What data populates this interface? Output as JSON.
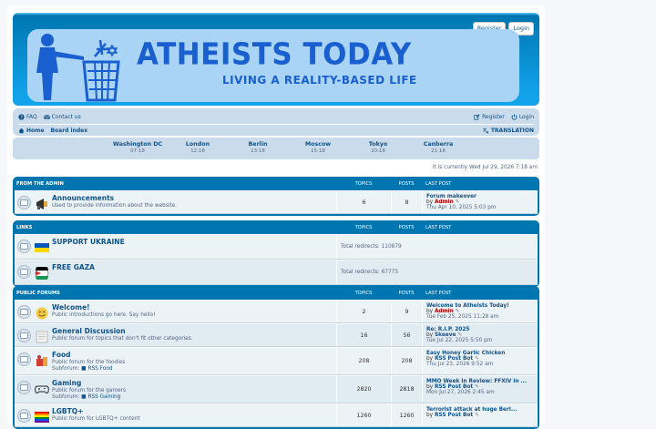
{
  "header": {
    "register": "Register",
    "login": "Login",
    "title": "ATHEISTS TODAY",
    "subtitle": "LIVING A REALITY-BASED LIFE"
  },
  "nav": {
    "faq": "FAQ",
    "contact": "Contact us",
    "register": "Register",
    "login": "Login",
    "home": "Home",
    "board_index": "Board index",
    "translation": "TRANSLATION"
  },
  "clocks": [
    {
      "city": "Washington DC",
      "time": "07:18"
    },
    {
      "city": "London",
      "time": "12:18"
    },
    {
      "city": "Berlin",
      "time": "13:18"
    },
    {
      "city": "Moscow",
      "time": "15:18"
    },
    {
      "city": "Tokyo",
      "time": "20:18"
    },
    {
      "city": "Canberra",
      "time": "21:18"
    }
  ],
  "current_time": "It is currently Wed Jul 29, 2026 7:18 am",
  "columns": {
    "topics": "TOPICS",
    "posts": "POSTS",
    "last_post": "LAST POST"
  },
  "categories": [
    {
      "name": "FROM THE ADMIN",
      "forums": [
        {
          "title": "Announcements",
          "desc": "Used to provide information about the website.",
          "topics": "6",
          "posts": "8",
          "last_title": "Forum makeover",
          "by": "by",
          "last_user": "Admin",
          "last_date": "Thu Apr 10, 2025 5:03 pm"
        }
      ]
    },
    {
      "name": "LINKS",
      "forums": [
        {
          "title": "SUPPORT UKRAINE",
          "redirects": "Total redirects: 110879"
        },
        {
          "title": "FREE GAZA",
          "redirects": "Total redirects: 67775"
        }
      ]
    },
    {
      "name": "PUBLIC FORUMS",
      "forums": [
        {
          "title": "Welcome!",
          "desc": "Public introductions go here. Say hello!",
          "topics": "2",
          "posts": "9",
          "last_title": "Welcome to Atheists Today!",
          "by": "by",
          "last_user": "Admin",
          "last_date": "Tue Feb 25, 2025 11:28 am"
        },
        {
          "title": "General Discussion",
          "desc": "Public forum for topics that don't fit other categories.",
          "topics": "16",
          "posts": "56",
          "last_title": "Re: R.I.P. 2025",
          "by": "by",
          "last_user": "Skeeve",
          "last_date": "Tue Jul 22, 2025 5:50 pm"
        },
        {
          "title": "Food",
          "desc": "Public forum for the foodies",
          "subforum_label": "Subforum:",
          "subforum": "RSS Food",
          "topics": "208",
          "posts": "208",
          "last_title": "Easy Honey Garlic Chicken",
          "by": "by",
          "last_user": "RSS Post Bot",
          "last_date": "Thu Jul 23, 2026 9:52 am"
        },
        {
          "title": "Gaming",
          "desc": "Public forum for the gamers",
          "subforum_label": "Subforum:",
          "subforum": "RSS Gaming",
          "topics": "2820",
          "posts": "2818",
          "last_title": "MMO Week in Review: FFXIV in ...",
          "by": "by",
          "last_user": "RSS Post Bot",
          "last_date": "Mon Jul 27, 2026 2:45 am"
        },
        {
          "title": "LGBTQ+",
          "desc": "Public forum for LGBTQ+ content",
          "topics": "1260",
          "posts": "1260",
          "last_title": "Terrorist attack at huge Berl...",
          "by": "by",
          "last_user": "RSS Post Bot",
          "last_date": ""
        }
      ]
    }
  ],
  "colors": {
    "primary": "#0076b1",
    "link": "#105289",
    "admin": "#aa0000",
    "nav_bg": "#cadceb"
  }
}
